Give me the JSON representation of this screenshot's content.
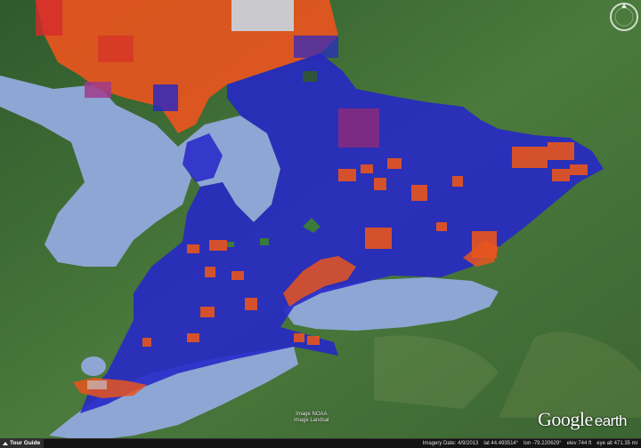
{
  "app": {
    "name": "Google Earth"
  },
  "imagery_credits": [
    "Image NOAA",
    "Image Landsat"
  ],
  "logo": {
    "word1": "Google",
    "word2": "earth"
  },
  "statusbar": {
    "tour_guide": "Tour Guide",
    "imagery_date": "Imagery Date: 4/9/2013",
    "lat": "lat 44.493514°",
    "lon": "lon -79.220629°",
    "elev": "elev 744 ft",
    "eye_alt": "eye alt 471.35 mi"
  },
  "colors": {
    "land": "#3f6a35",
    "water": "#8ea6d4",
    "overlay_primary": "#2626c8",
    "overlay_secondary": "#e8551e",
    "overlay_tertiary": "#d62a2a"
  },
  "icons": {
    "navigation": "compass-ring-icon",
    "tour_guide": "chevron-up-icon"
  }
}
